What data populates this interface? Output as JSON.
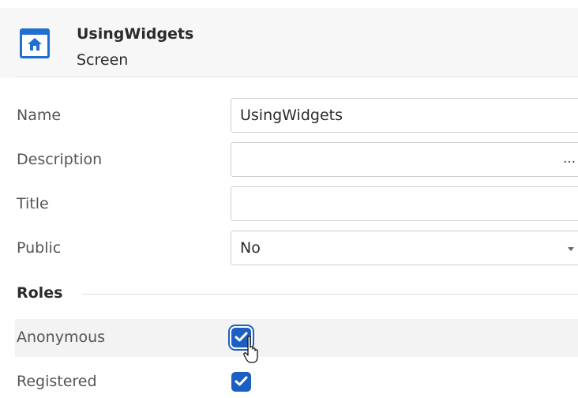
{
  "header": {
    "icon": "home-screen-icon",
    "title": "UsingWidgets",
    "subtitle": "Screen",
    "accent_color": "#1f6fd1"
  },
  "properties": {
    "name": {
      "label": "Name",
      "value": "UsingWidgets"
    },
    "description": {
      "label": "Description",
      "value": "",
      "button": "..."
    },
    "title": {
      "label": "Title",
      "value": ""
    },
    "public": {
      "label": "Public",
      "value": "No"
    }
  },
  "roles": {
    "heading": "Roles",
    "items": [
      {
        "label": "Anonymous",
        "checked": true
      },
      {
        "label": "Registered",
        "checked": true
      }
    ],
    "checkbox_color": "#1b5fc4"
  }
}
